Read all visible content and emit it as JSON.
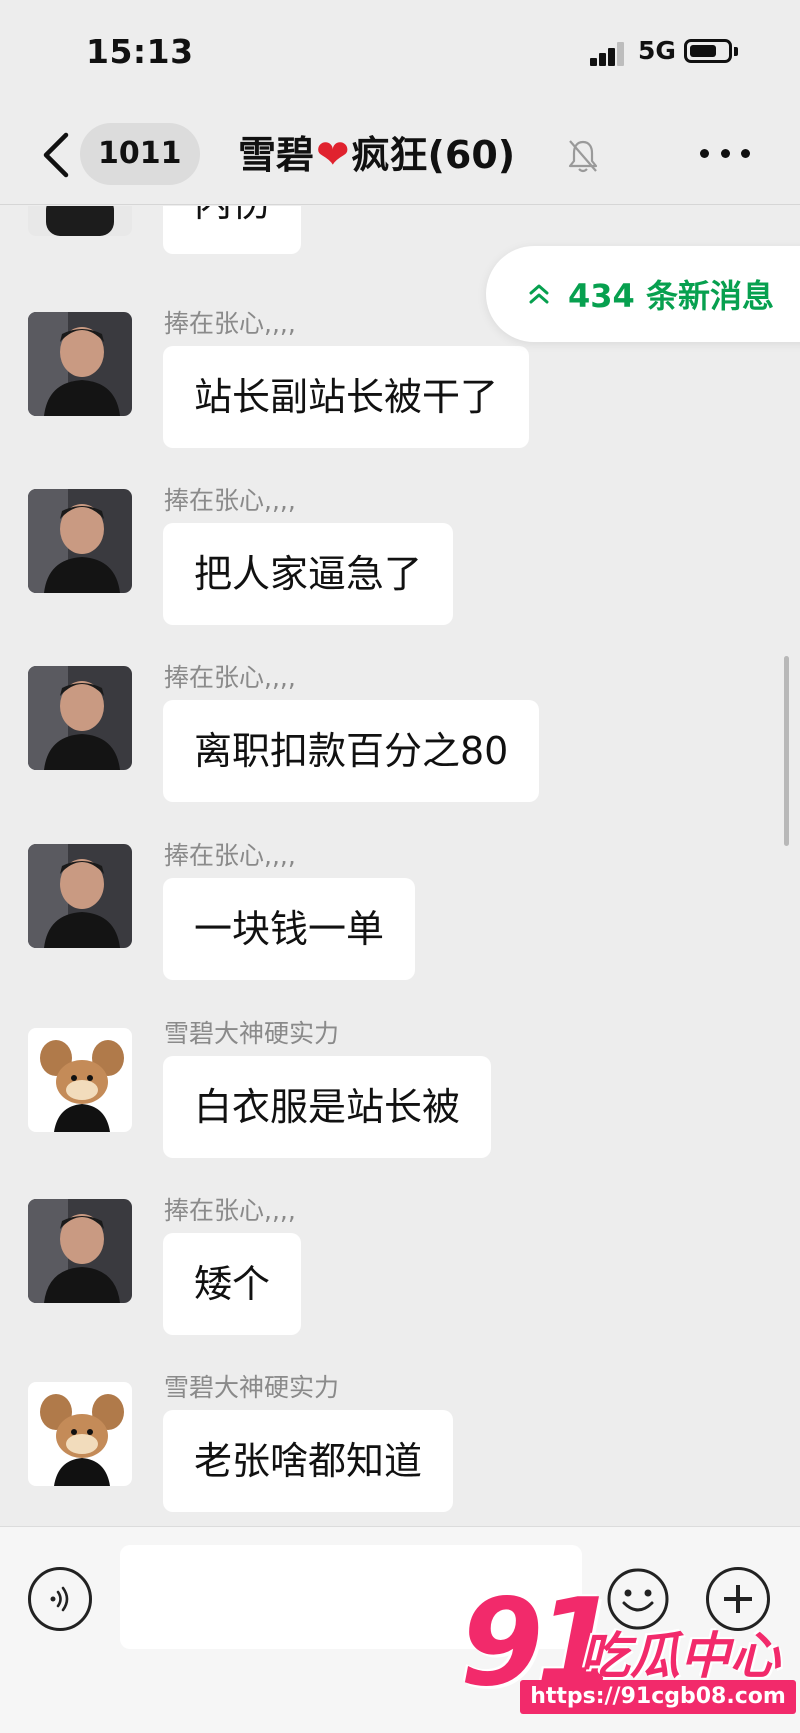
{
  "status_bar": {
    "time": "15:13",
    "network": "5G"
  },
  "nav": {
    "unread_count": "1011",
    "title_left": "雪碧",
    "title_heart": "❤",
    "title_right": "疯狂(60)",
    "mute_icon": "bell-muted-icon",
    "more_icon": "ellipsis-icon"
  },
  "new_messages": {
    "label": "434 条新消息",
    "color": "#07a04f"
  },
  "messages": [
    {
      "sender": "",
      "text": "内伤",
      "avatar": "man-photo"
    },
    {
      "sender": "捧在张心,,,,",
      "text": "站长副站长被干了",
      "avatar": "man-photo"
    },
    {
      "sender": "捧在张心,,,,",
      "text": "把人家逼急了",
      "avatar": "man-photo"
    },
    {
      "sender": "捧在张心,,,,",
      "text": "离职扣款百分之80",
      "avatar": "man-photo"
    },
    {
      "sender": "捧在张心,,,,",
      "text": "一块钱一单",
      "avatar": "man-photo"
    },
    {
      "sender": "雪碧大神硬实力",
      "text": "白衣服是站长被",
      "avatar": "cartoon-mouse"
    },
    {
      "sender": "捧在张心,,,,",
      "text": "矮个",
      "avatar": "man-photo"
    },
    {
      "sender": "雪碧大神硬实力",
      "text": "老张啥都知道",
      "avatar": "cartoon-mouse"
    }
  ],
  "input_bar": {
    "voice_icon": "voice-icon",
    "emoji_icon": "emoji-icon",
    "plus_icon": "plus-icon",
    "placeholder": ""
  },
  "watermark": {
    "number": "91",
    "name": "吃瓜中心",
    "url": "https://91cgb08.com",
    "color": "#f22a6b"
  }
}
